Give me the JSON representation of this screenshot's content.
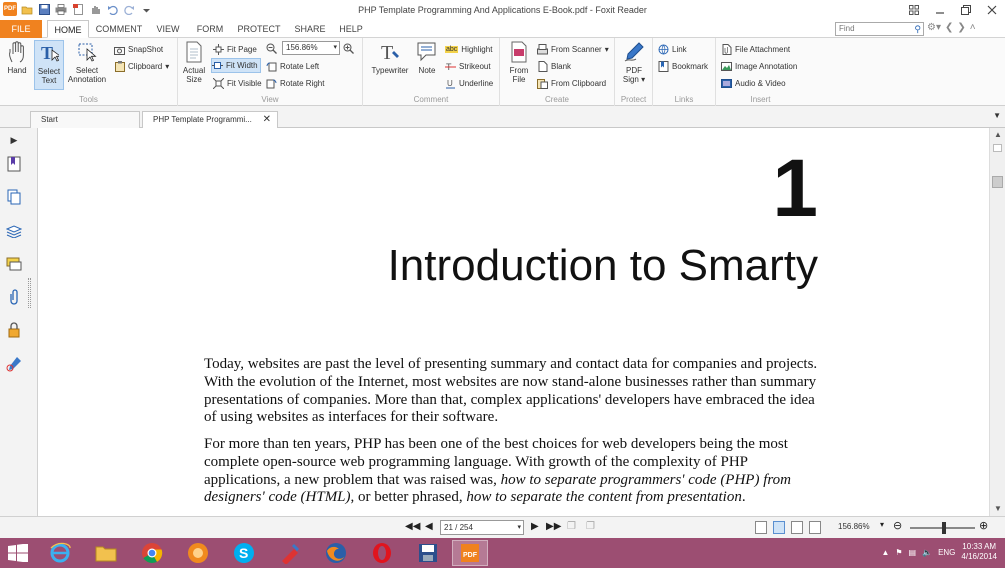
{
  "window": {
    "title": "PHP Template Programming And Applications E-Book.pdf - Foxit Reader",
    "app_icon_label": "PDF"
  },
  "ribbon_tabs": [
    "FILE",
    "HOME",
    "COMMENT",
    "VIEW",
    "FORM",
    "PROTECT",
    "SHARE",
    "HELP"
  ],
  "active_tab": "HOME",
  "find": {
    "placeholder": "Find"
  },
  "ribbon": {
    "tools": {
      "label": "Tools",
      "hand": "Hand",
      "select_text_1": "Select",
      "select_text_2": "Text",
      "select_annotation_1": "Select",
      "select_annotation_2": "Annotation",
      "snapshot": "SnapShot",
      "clipboard": "Clipboard"
    },
    "view": {
      "label": "View",
      "actual_size_1": "Actual",
      "actual_size_2": "Size",
      "fit_page": "Fit Page",
      "fit_width": "Fit Width",
      "fit_visible": "Fit Visible",
      "zoom_value": "156.86%",
      "rotate_left": "Rotate Left",
      "rotate_right": "Rotate Right"
    },
    "comment": {
      "label": "Comment",
      "typewriter": "Typewriter",
      "note": "Note",
      "highlight": "Highlight",
      "highlight_badge": "abc",
      "strikeout": "Strikeout",
      "underline": "Underline"
    },
    "create": {
      "label": "Create",
      "from_file_1": "From",
      "from_file_2": "File",
      "from_scanner": "From Scanner",
      "blank": "Blank",
      "from_clipboard": "From Clipboard"
    },
    "protect": {
      "label": "Protect",
      "pdf_sign_1": "PDF",
      "pdf_sign_2": "Sign"
    },
    "links": {
      "label": "Links",
      "link": "Link",
      "bookmark": "Bookmark"
    },
    "insert": {
      "label": "Insert",
      "file_attachment": "File Attachment",
      "image_annotation": "Image Annotation",
      "audio_video": "Audio & Video"
    }
  },
  "doc_tabs": [
    {
      "label": "Start"
    },
    {
      "label": "PHP Template Programmi..."
    }
  ],
  "document": {
    "chapter_number": "1",
    "chapter_title": "Introduction to Smarty",
    "para1": "Today, websites are past the level of presenting summary and contact data for companies and projects. With the evolution of the Internet, most websites are now stand-alone businesses rather than summary presentations of companies. More than that, complex applications' developers have embraced the idea of using websites as interfaces for their software.",
    "para2_a": "For more than ten years, PHP has been one of the best choices for web developers being the most complete open-source web programming language. With growth of the complexity of PHP applications, a new problem that was raised was, ",
    "para2_i1": "how to separate programmers' code (PHP) from designers' code (HTML)",
    "para2_b": ", or better phrased, ",
    "para2_i2": "how to separate the content from presentation",
    "para2_c": "."
  },
  "statusbar": {
    "page": "21 / 254",
    "zoom": "156.86%"
  },
  "taskbar": {
    "language": "ENG",
    "time": "10:33 AM",
    "date": "4/16/2014"
  },
  "colors": {
    "accent": "#f0821f",
    "taskbar": "#9c4e72",
    "selection": "#cfe3f7"
  }
}
